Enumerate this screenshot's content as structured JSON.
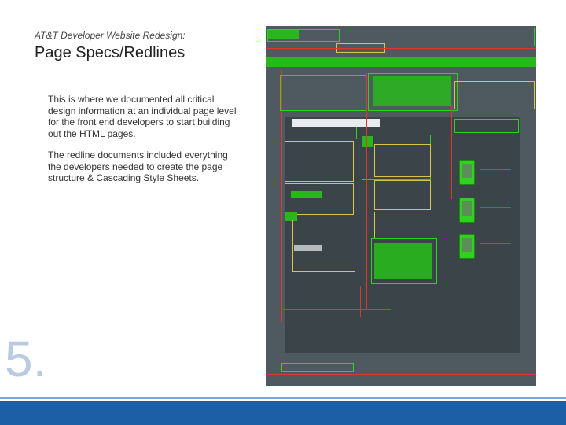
{
  "slide": {
    "subtitle": "AT&T Developer Website Redesign:",
    "title": "Page Specs/Redlines",
    "paragraph1": "This is where we documented all critical design information at an individual page level for the front end developers to start building out the HTML pages.",
    "paragraph2": "The redline documents included everything the developers needed to create the page structure & Cascading Style Sheets.",
    "number": "5."
  },
  "colors": {
    "accent_bar": "#1d5fa6",
    "redline_green": "#28b81c",
    "redline_red": "#d93a2a"
  },
  "icons": [
    "redline-screenshot-image"
  ]
}
